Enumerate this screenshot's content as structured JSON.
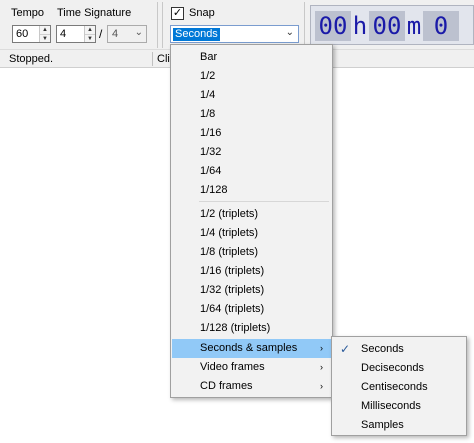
{
  "toolbar": {
    "tempo_label": "Tempo",
    "tempo_value": "60",
    "time_signature_label": "Time Signature",
    "ts_numerator": "4",
    "ts_divider": "/",
    "ts_denominator": "4",
    "spin_up": "▲",
    "spin_down": "▼",
    "dropdown_arrow": "⌄",
    "snap_checked_glyph": "✓",
    "snap_label": "Snap",
    "snap_value": "Seconds"
  },
  "timecode": {
    "hours": "00",
    "h": "h",
    "minutes": "00",
    "m": "m",
    "seconds": "0"
  },
  "status": {
    "text": "Stopped.",
    "clip_text": "Cli"
  },
  "menu": {
    "items": [
      "Bar",
      "1/2",
      "1/4",
      "1/8",
      "1/16",
      "1/32",
      "1/64",
      "1/128"
    ],
    "triplets": [
      "1/2 (triplets)",
      "1/4 (triplets)",
      "1/8 (triplets)",
      "1/16 (triplets)",
      "1/32 (triplets)",
      "1/64 (triplets)",
      "1/128 (triplets)"
    ],
    "submenus": [
      "Seconds & samples",
      "Video frames",
      "CD frames"
    ],
    "submenu_arrow": "›"
  },
  "submenu": {
    "items": [
      "Seconds",
      "Deciseconds",
      "Centiseconds",
      "Milliseconds",
      "Samples"
    ],
    "checked_glyph": "✓"
  }
}
